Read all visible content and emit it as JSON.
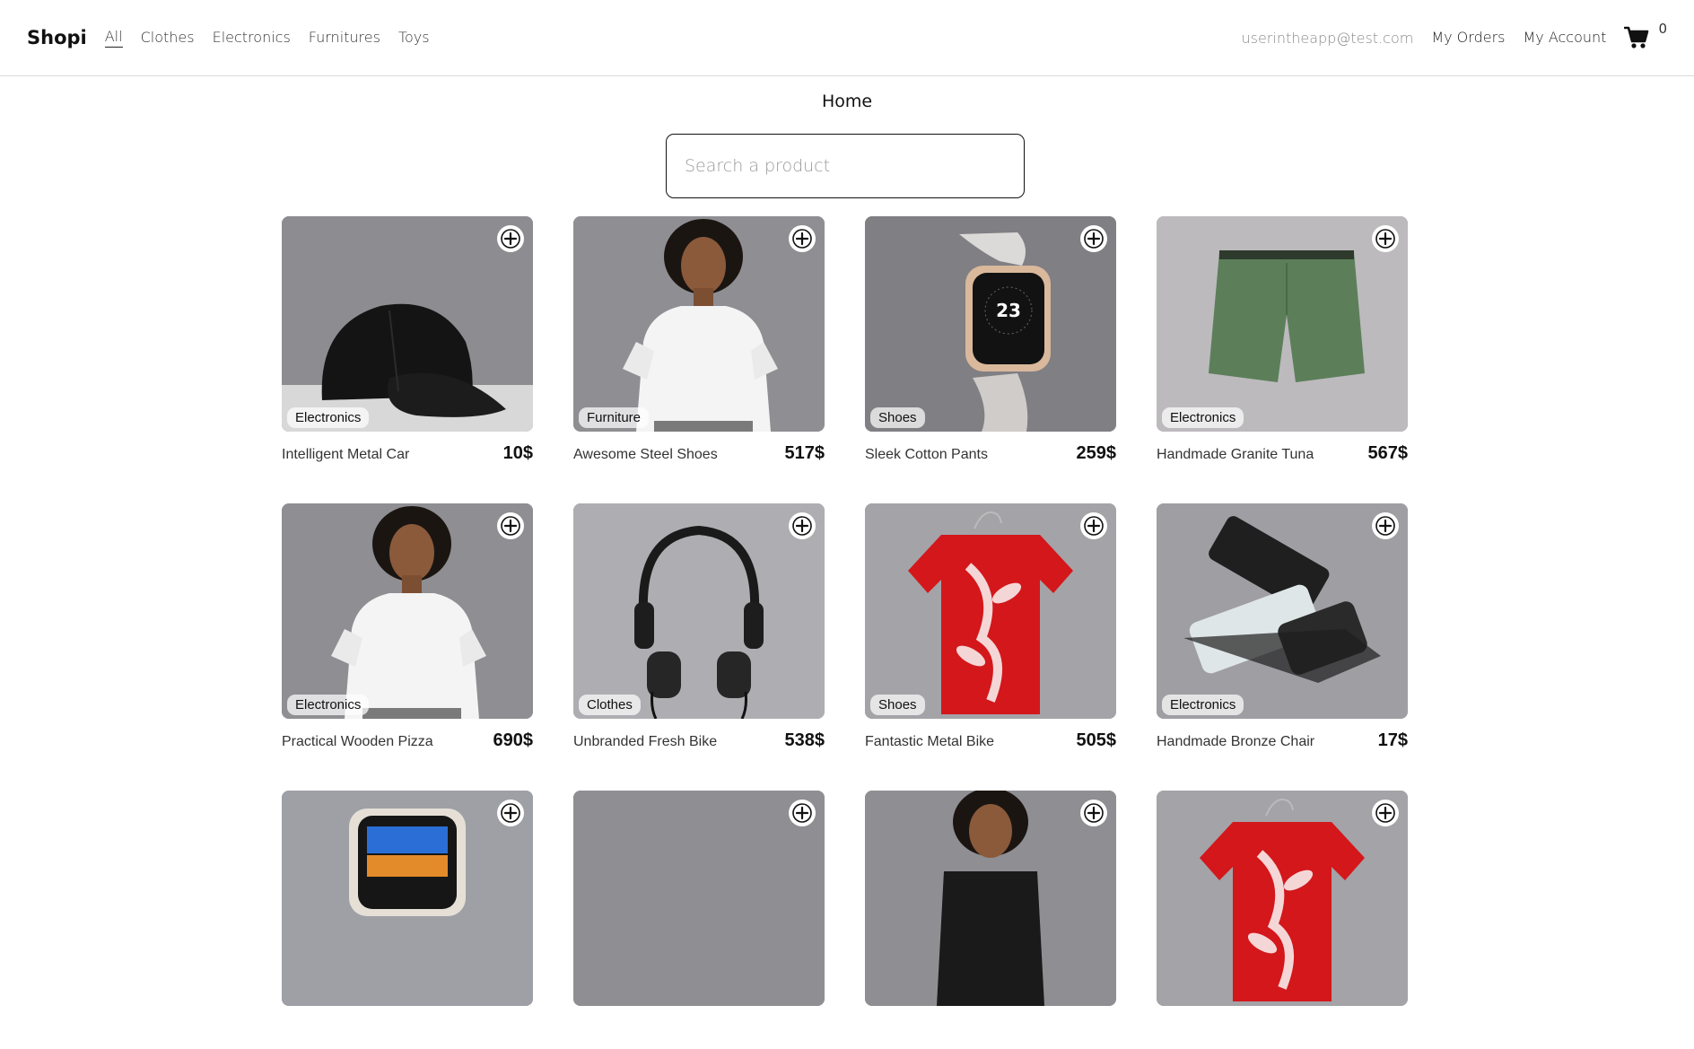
{
  "navbar": {
    "brand": "Shopi",
    "categories": [
      "All",
      "Clothes",
      "Electronics",
      "Furnitures",
      "Toys"
    ],
    "active_category": "All",
    "email": "userintheapp@test.com",
    "my_orders": "My Orders",
    "my_account": "My Account",
    "cart_count": "0"
  },
  "main": {
    "title": "Home",
    "search_placeholder": "Search a product"
  },
  "products": [
    {
      "name": "Intelligent Metal Car",
      "price": "10$",
      "category": "Electronics",
      "image": "cap"
    },
    {
      "name": "Awesome Steel Shoes",
      "price": "517$",
      "category": "Furniture",
      "image": "woman"
    },
    {
      "name": "Sleek Cotton Pants",
      "price": "259$",
      "category": "Shoes",
      "image": "watch"
    },
    {
      "name": "Handmade Granite Tuna",
      "price": "567$",
      "category": "Electronics",
      "image": "shorts"
    },
    {
      "name": "Practical Wooden Pizza",
      "price": "690$",
      "category": "Electronics",
      "image": "woman"
    },
    {
      "name": "Unbranded Fresh Bike",
      "price": "538$",
      "category": "Clothes",
      "image": "headphones"
    },
    {
      "name": "Fantastic Metal Bike",
      "price": "505$",
      "category": "Shoes",
      "image": "tshirt"
    },
    {
      "name": "Handmade Bronze Chair",
      "price": "17$",
      "category": "Electronics",
      "image": "phones"
    },
    {
      "name": "",
      "price": "",
      "category": "",
      "image": "smartwatch"
    },
    {
      "name": "",
      "price": "",
      "category": "",
      "image": "plain"
    },
    {
      "name": "",
      "price": "",
      "category": "",
      "image": "woman-dark"
    },
    {
      "name": "",
      "price": "",
      "category": "",
      "image": "tshirt"
    }
  ],
  "colors": {
    "border": "#d9d9d9",
    "thumb_bg": "#8e8d91",
    "text": "#111111",
    "muted": "#8a8a8a"
  }
}
